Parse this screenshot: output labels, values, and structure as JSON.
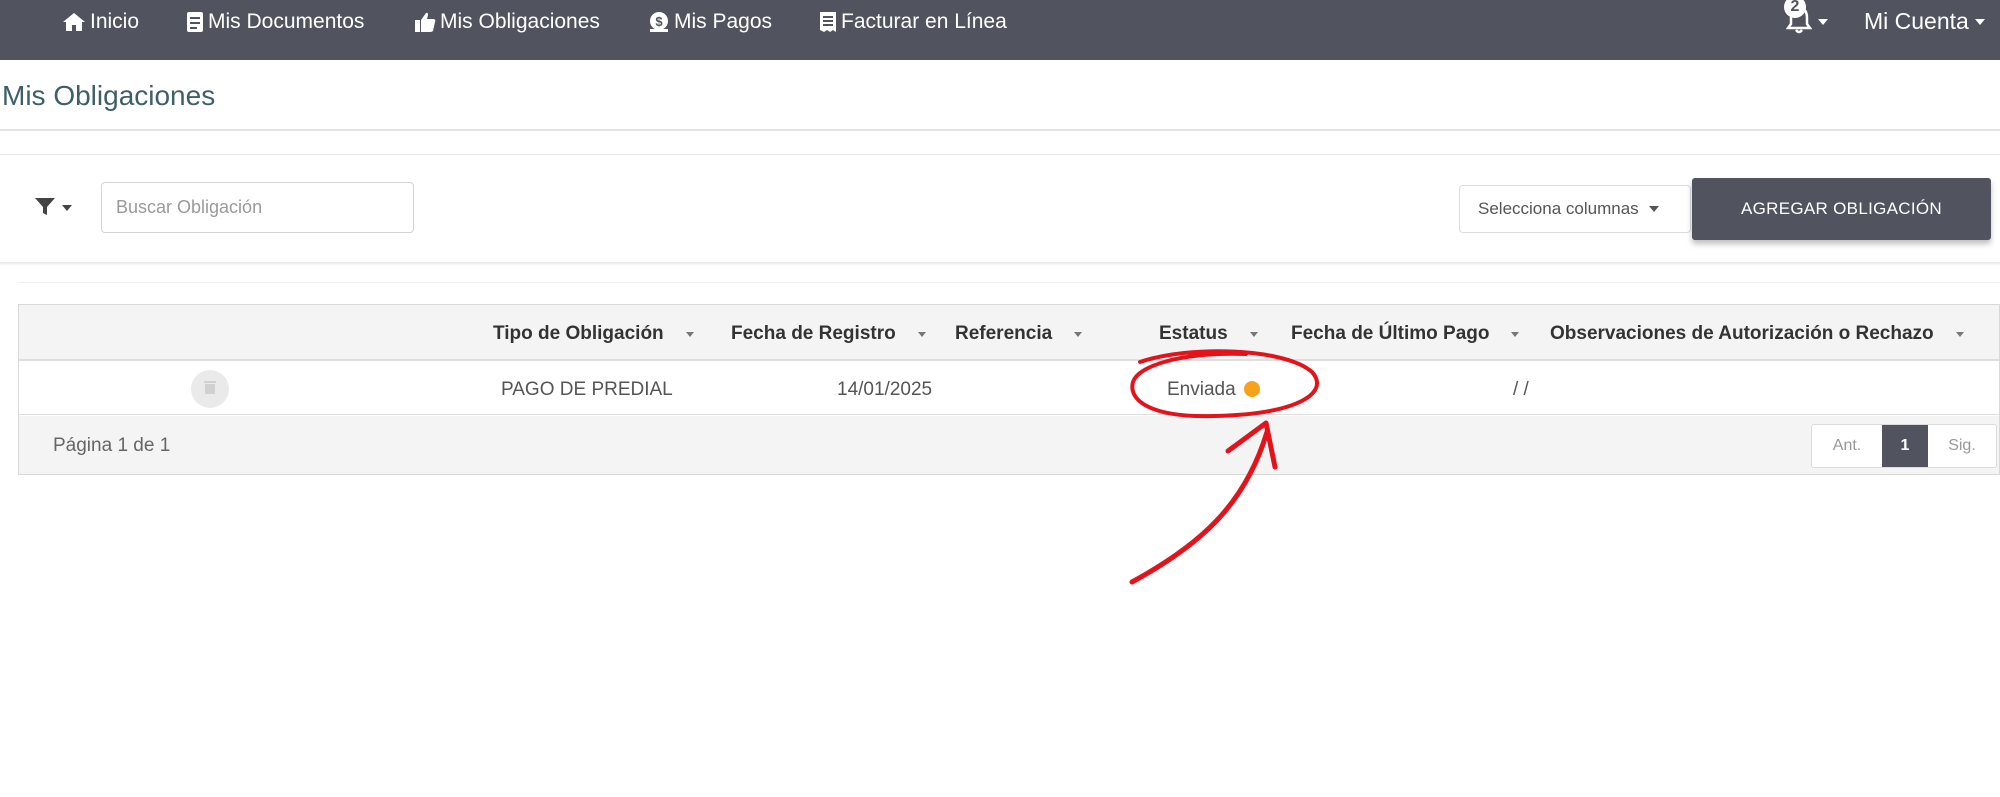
{
  "nav": {
    "items": [
      {
        "label": "Inicio",
        "icon": "home-icon"
      },
      {
        "label": "Mis Documentos",
        "icon": "document-icon"
      },
      {
        "label": "Mis Obligaciones",
        "icon": "thumbs-up-icon"
      },
      {
        "label": "Mis Pagos",
        "icon": "money-icon"
      },
      {
        "label": "Facturar en Línea",
        "icon": "receipt-icon"
      }
    ],
    "notification_count": "2",
    "account_label": "Mi Cuenta"
  },
  "page": {
    "title": "Mis Obligaciones"
  },
  "toolbar": {
    "search_placeholder": "Buscar Obligación",
    "columns_select_label": "Selecciona columnas",
    "add_button_label": "AGREGAR OBLIGACIÓN"
  },
  "table": {
    "columns": [
      "Tipo de Obligación",
      "Fecha de Registro",
      "Referencia",
      "Estatus",
      "Fecha de Último Pago",
      "Observaciones de Autorización o Rechazo"
    ],
    "rows": [
      {
        "tipo": "PAGO DE PREDIAL",
        "fecha_registro": "14/01/2025",
        "referencia": "",
        "estatus": "Enviada",
        "fecha_ultimo_pago": "/ /",
        "observaciones": ""
      }
    ],
    "page_info": "Página 1 de 1",
    "pager": {
      "prev": "Ant.",
      "current": "1",
      "next": "Sig."
    }
  },
  "colors": {
    "navbar": "#51545e",
    "status_enviada": "#f7a21b",
    "annotation": "#e3131b",
    "title": "#3f5f66"
  }
}
